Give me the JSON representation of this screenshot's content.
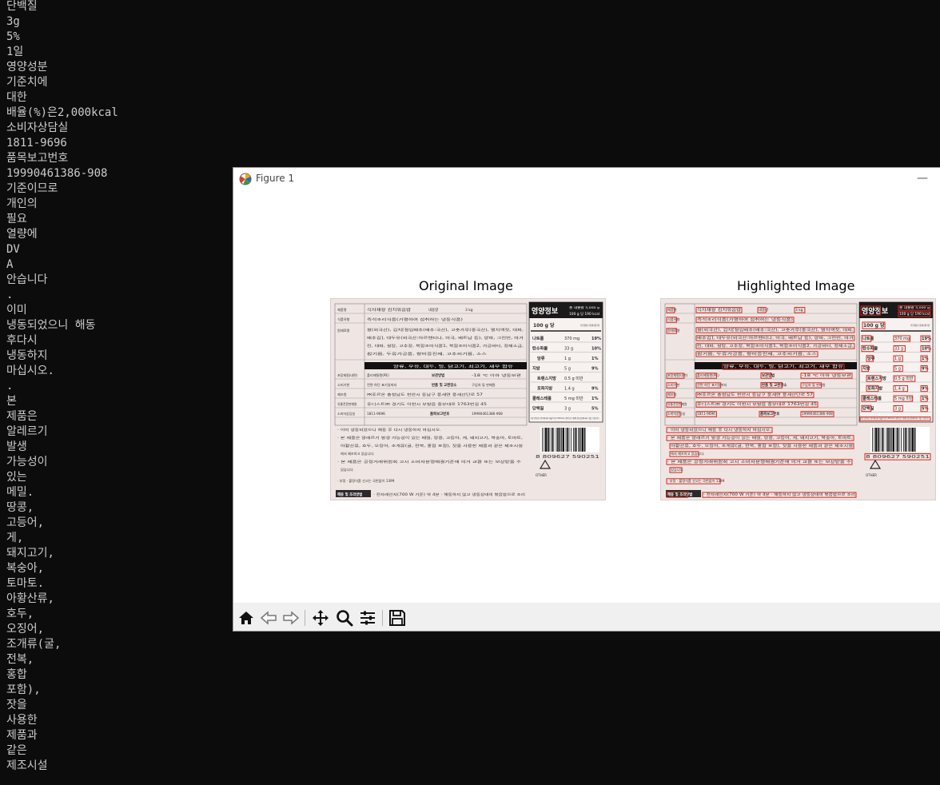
{
  "terminal": {
    "lines": [
      "단백질",
      "3g",
      "5%",
      "1일",
      "영양성분",
      "기준치에",
      "대한",
      "배율(%)은2,000kcal",
      "소비자상담실",
      "1811-9696",
      "품목보고번호",
      "19990461386-908",
      "기준이므로",
      "개인의",
      "필요",
      "열량에",
      "DV",
      "A",
      "안습니다",
      ".",
      "이미",
      "냉동되었으니 해동",
      "후다시",
      "냉동하지",
      "마십시오.",
      ".",
      "본",
      "제품은",
      "알레르기",
      "발생",
      "가능성이",
      "있는",
      "메밀.",
      "땅콩,",
      "고등어,",
      "게,",
      "돼지고기,",
      "복숭아,",
      "토마토.",
      "아황산류,",
      "호두,",
      "오징어,",
      "조개류(굴,",
      "전복,",
      "홍합",
      "포함),",
      "잣을",
      "사용한",
      "제품과",
      "같은",
      "제조시설"
    ]
  },
  "window": {
    "title": "Figure 1",
    "minimize": "—"
  },
  "figure": {
    "original_title": "Original Image",
    "highlighted_title": "Highlighted Image",
    "label": {
      "product_name_header": "제품명",
      "product_name": "식자재왕 김치볶음밥",
      "content_header": "내용량",
      "content": "3 kg",
      "type_header": "식품유형",
      "type": "즉석조리식품(가열하여 섭취하는 냉동식품)",
      "ingredients_header": "원재료명",
      "ingredients_1": "쌀(외국산), 김치[절임배추(배추:국산), 고춧가루(중국산), 멸치액젓, 대파,",
      "ingredients_2": "배추김], 대두유(외국산:아르헨티나, 미국, 베트남 등), 양파, 그린빈, 마가",
      "ingredients_3": "린, 대파, 설탕, 고추장, 복합조미식품1, 복합조미식품2, 가공버터, 정제소금,",
      "ingredients_4": "참기름, 두류가공품, 향미증진제, 고추씨기름, 소스",
      "allergy_banner": "알류, 우유, 대두, 밀, 닭고기, 쇠고기, 새우 함유",
      "packaging_header": "포장재질(내면)",
      "packaging": "폴리에틸렌(PE)",
      "storage_header": "보관방법",
      "storage": "-18 ℃ 이하 냉동보관",
      "expiry_header": "소비기한",
      "expiry": "전면 하단 표기일까지",
      "return_header": "반품 및 교환장소",
      "return": "구입처 및 판매원",
      "maker_header": "제조원",
      "maker": "㈜푸르온 충청남도 천안시 동남구 풍세면 풍세산단로 57",
      "seller_header": "유통전문판매원",
      "seller": "푸디스트㈜ 경기도 이천시 부발읍 중부대로 1763번길 45",
      "consumer_header": "소비자상담실",
      "consumer": "1811-9696",
      "report_header": "품목보고번호",
      "report": "19990461386-908",
      "notice_1": "· 이미 냉동되었으니 해동 후 다시 냉동하지 마십시오.",
      "notice_2": "· 본 제품은 알레르기 발생 가능성이 있는 메밀, 땅콩, 고등어, 게, 돼지고기, 복숭아, 토마토,",
      "notice_3": "아황산류, 호두, 오징어, 조개류(굴, 전복, 홍합 포함), 잣을 사용한 제품과 같은 제조시설",
      "notice_4": "에서 제조하고 있습니다.",
      "notice_5": "· 본 제품은 공정거래위원회 고시 소비자분쟁해결기준에 의거 교환 또는 보상받을 수",
      "notice_6": "있습니다.",
      "notice_7": "· 부정 · 불량식품 신고는 국번없이 1399",
      "cooking_header": "해동 및 조리방법",
      "cooking": "· 전자레인지(700 W 기준) 약 4분 · 해동하지 않고 냉동상태의 볶음밥으로 조리",
      "nutrition_title": "영양정보",
      "nutrition_total": "총 내용량 3,000 g",
      "nutrition_total_kcal": "100 g 당 190 kcal",
      "per_100g": "100 g 당",
      "daily_ratio_header": "1일 영양성분 기준치에 대한 비율",
      "nutrients": [
        {
          "name": "나트륨",
          "amount": "370 mg",
          "pct": "19%"
        },
        {
          "name": "탄수화물",
          "amount": "33 g",
          "pct": "10%"
        },
        {
          "name": "당류",
          "amount": "1 g",
          "pct": "1%"
        },
        {
          "name": "지방",
          "amount": "5 g",
          "pct": "9%"
        },
        {
          "name": "트랜스지방",
          "amount": "0.5 g 미만",
          "pct": ""
        },
        {
          "name": "포화지방",
          "amount": "1.4 g",
          "pct": "9%"
        },
        {
          "name": "콜레스테롤",
          "amount": "5 mg 미만",
          "pct": "1%"
        },
        {
          "name": "단백질",
          "amount": "3 g",
          "pct": "5%"
        }
      ],
      "daily_note": "1일 영양성분 기준치에 대한 비율(%)은 2,000 kcal 기준이므로 개인의 필요 열량에 따라 다를 수 있습니다.",
      "barcode_number": "8 809627 590251",
      "recycle_mark": "OTHER"
    }
  },
  "toolbar": {
    "buttons": [
      "home-icon",
      "back-arrow-icon",
      "forward-arrow-icon",
      "pan-move-icon",
      "zoom-magnifier-icon",
      "configure-sliders-icon",
      "save-floppy-icon"
    ]
  },
  "colors": {
    "terminal_bg": "#0c0c0c",
    "terminal_text": "#cccccc",
    "highlight_box": "#e0241c",
    "label_paper": "#f2ece9",
    "toolbar_bg": "#f0f0f0"
  }
}
